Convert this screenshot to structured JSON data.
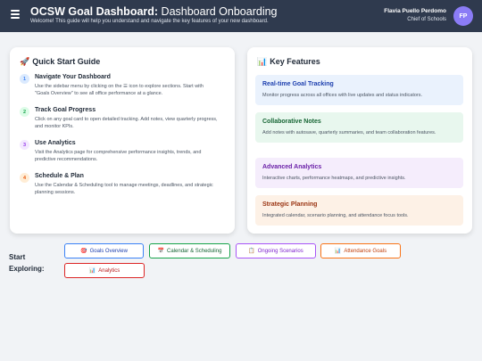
{
  "header": {
    "title_bold": "OCSW Goal Dashboard:",
    "title_rest": " Dashboard Onboarding",
    "subtitle": "Welcome! This guide will help you understand and navigate the key features of your new dashboard.",
    "user_name": "Flavia Puello Perdomo",
    "user_role": "Chief of Schools",
    "avatar_initials": "FP",
    "menu_icon": "hamburger-icon"
  },
  "quick_start": {
    "icon": "🚀",
    "title": "Quick Start Guide",
    "steps": [
      {
        "num": "1",
        "title": "Navigate Your Dashboard",
        "desc": "Use the sidebar menu by clicking on the ☰ icon to explore sections. Start with \"Goals Overview\" to see all office performance at a glance.",
        "color": "#3b82f6",
        "bg": "#dbeafe"
      },
      {
        "num": "2",
        "title": "Track Goal Progress",
        "desc": "Click on any goal card to open detailed tracking. Add notes, view quarterly progress, and monitor KPIs.",
        "color": "#16a34a",
        "bg": "#dcfce7"
      },
      {
        "num": "3",
        "title": "Use Analytics",
        "desc": "Visit the Analytics page for comprehensive performance insights, trends, and predictive recommendations.",
        "color": "#9333ea",
        "bg": "#f3e8ff"
      },
      {
        "num": "4",
        "title": "Schedule & Plan",
        "desc": "Use the Calendar & Scheduling tool to manage meetings, deadlines, and strategic planning sessions.",
        "color": "#ea580c",
        "bg": "#ffedd5"
      }
    ]
  },
  "key_features": {
    "icon": "📊",
    "title": "Key Features",
    "items": [
      {
        "title": "Real-time Goal Tracking",
        "desc": "Monitor progress across all offices with live updates and status indicators.",
        "color": "#1e40af",
        "bg": "#eaf2fd"
      },
      {
        "title": "Collaborative Notes",
        "desc": "Add notes with autosave, quarterly summaries, and team collaboration features.",
        "color": "#166534",
        "bg": "#e8f7ee"
      },
      {
        "title": "Advanced Analytics",
        "desc": "Interactive charts, performance heatmaps, and predictive insights.",
        "color": "#6b21a8",
        "bg": "#f5edfc"
      },
      {
        "title": "Strategic Planning",
        "desc": "Integrated calendar, scenario planning, and attendance focus tools.",
        "color": "#9a3412",
        "bg": "#fdf1e6"
      }
    ]
  },
  "start_exploring": {
    "label_line1": "Start",
    "label_line2": "Exploring:",
    "buttons": [
      {
        "icon": "🎯",
        "label": "Goals Overview",
        "color": "#3b82f6",
        "text_color": "#1e40af"
      },
      {
        "icon": "📅",
        "label": "Calendar & Scheduling",
        "color": "#16a34a",
        "text_color": "#166534"
      },
      {
        "icon": "📋",
        "label": "Ongoing Scenarios",
        "color": "#a855f7",
        "text_color": "#7e22ce"
      },
      {
        "icon": "📊",
        "label": "Attendance Goals",
        "color": "#f97316",
        "text_color": "#c2410c"
      },
      {
        "icon": "📊",
        "label": "Analytics",
        "color": "#dc2626",
        "text_color": "#b91c1c"
      }
    ]
  }
}
